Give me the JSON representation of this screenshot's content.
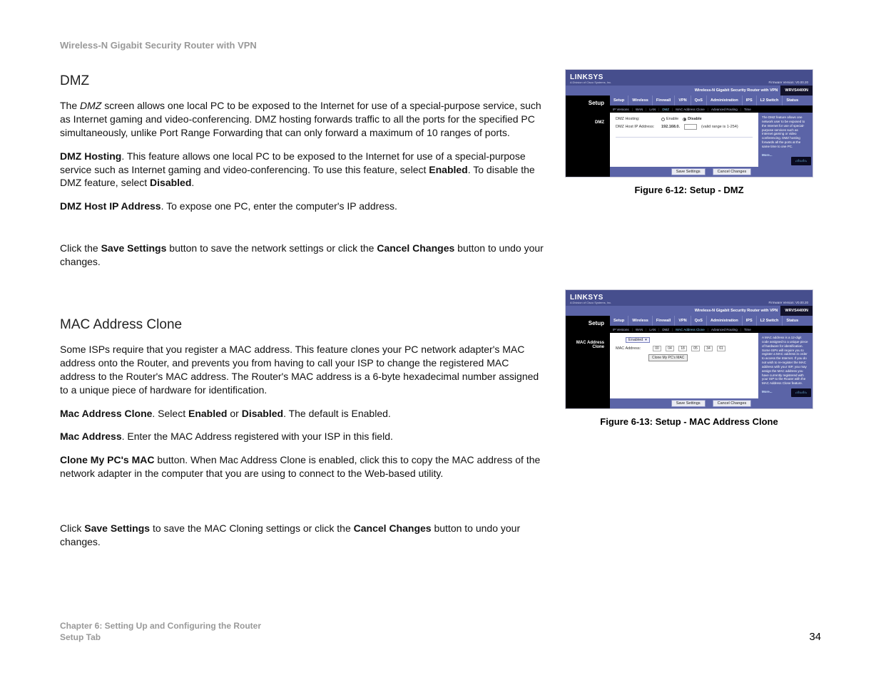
{
  "header": "Wireless-N Gigabit Security Router with VPN",
  "dmz": {
    "title": "DMZ",
    "p1_a": "The ",
    "p1_i": "DMZ",
    "p1_b": " screen allows one local PC to be exposed to the Internet for use of a special-purpose service, such as Internet gaming and video-conferencing. DMZ hosting forwards traffic to all the ports for the specified PC simultaneously, unlike Port Range Forwarding that can only forward a maximum of 10 ranges of ports.",
    "p2_b1": "DMZ Hosting",
    "p2_a": ". This feature allows one local PC to be exposed to the Internet for use of a special-purpose service such as Internet gaming and video-conferencing. To use this feature, select ",
    "p2_b2": "Enabled",
    "p2_bmid": ". To disable the DMZ feature, select ",
    "p2_b3": "Disabled",
    "p2_end": ".",
    "p3_b": "DMZ Host IP Address",
    "p3_a": ". To expose one PC, enter the computer's IP address.",
    "p4_a": "Click the ",
    "p4_b1": "Save Settings",
    "p4_mid": " button to save the network settings or click the ",
    "p4_b2": "Cancel Changes",
    "p4_end": " button to undo your changes."
  },
  "mac": {
    "title": "MAC Address Clone",
    "p1": "Some ISPs require that you register a MAC address. This feature clones your PC network adapter's MAC address onto the Router, and prevents you from having to call your ISP to change the registered MAC address to the Router's MAC address. The Router's MAC address is a 6-byte hexadecimal number assigned to a unique piece of hardware for identification.",
    "p2_b": "Mac Address Clone",
    "p2_a": ". Select ",
    "p2_b2": "Enabled",
    "p2_mid": " or ",
    "p2_b3": "Disabled",
    "p2_end": ". The default is Enabled.",
    "p3_b": "Mac Address",
    "p3_a": ". Enter the MAC Address registered with your ISP in this field.",
    "p4_b": "Clone My PC's MAC",
    "p4_a": " button. When Mac Address Clone is enabled, click this to copy the MAC address of the network adapter in the computer that you are using to connect to the Web-based utility.",
    "p5_a": "Click ",
    "p5_b1": "Save Settings",
    "p5_mid": " to save the MAC Cloning settings or click the ",
    "p5_b2": "Cancel Changes",
    "p5_end": " button to undo your changes."
  },
  "router": {
    "logo": "LINKSYS",
    "logo_sub": "A Division of Cisco Systems, Inc.",
    "fw": "Firmware Version: V0.00.20",
    "product": "Wireless-N Gigabit Security Router with VPN",
    "model": "WRVS4400N",
    "side_main": "Setup",
    "tabs": [
      "Setup",
      "Wireless",
      "Firewall",
      "VPN",
      "QoS",
      "Administration",
      "IPS",
      "L2 Switch",
      "Status"
    ],
    "subtabs": [
      "IP Versions",
      "WAN",
      "LAN",
      "DMZ",
      "MAC Address Clone",
      "Advanced Routing",
      "Time"
    ],
    "save": "Save Settings",
    "cancel": "Cancel Changes"
  },
  "fig1": {
    "caption": "Figure 6-12: Setup - DMZ",
    "side_sub": "DMZ",
    "row1_label": "DMZ Hosting:",
    "row1_opt1": "Enable",
    "row1_opt2": "Disable",
    "row2_label": "DMZ Host IP Address:",
    "row2_prefix": "192.168.0.",
    "row2_hint": "(valid range is 1-254)",
    "help": "The DMZ feature allows one network user to be exposed to the Internet for use of special-purpose services such as Internet gaming or video conferencing. DMZ hosting forwards all the ports at the same time to one PC.",
    "more": "More..."
  },
  "fig2": {
    "caption": "Figure 6-13: Setup - MAC Address Clone",
    "side_sub": "MAC Address Clone",
    "select": "Enabled",
    "row_label": "MAC Address:",
    "mac": [
      "00",
      "04",
      "18",
      "05",
      "34",
      "61"
    ],
    "btn": "Clone My PC's MAC",
    "help": "A MAC address is a 12-digit code assigned to a unique piece of hardware for identification. Some ISPs will require you to register a MAC address in order to access the Internet. If you do not wish to re-register the MAC address with your ISP, you may assign the MAC address you have currently registered with your ISP to the Router with the MAC Address Clone feature.",
    "more": "More..."
  },
  "footer": {
    "l1": "Chapter 6: Setting Up and Configuring the Router",
    "l2": "Setup Tab",
    "page": "34"
  }
}
